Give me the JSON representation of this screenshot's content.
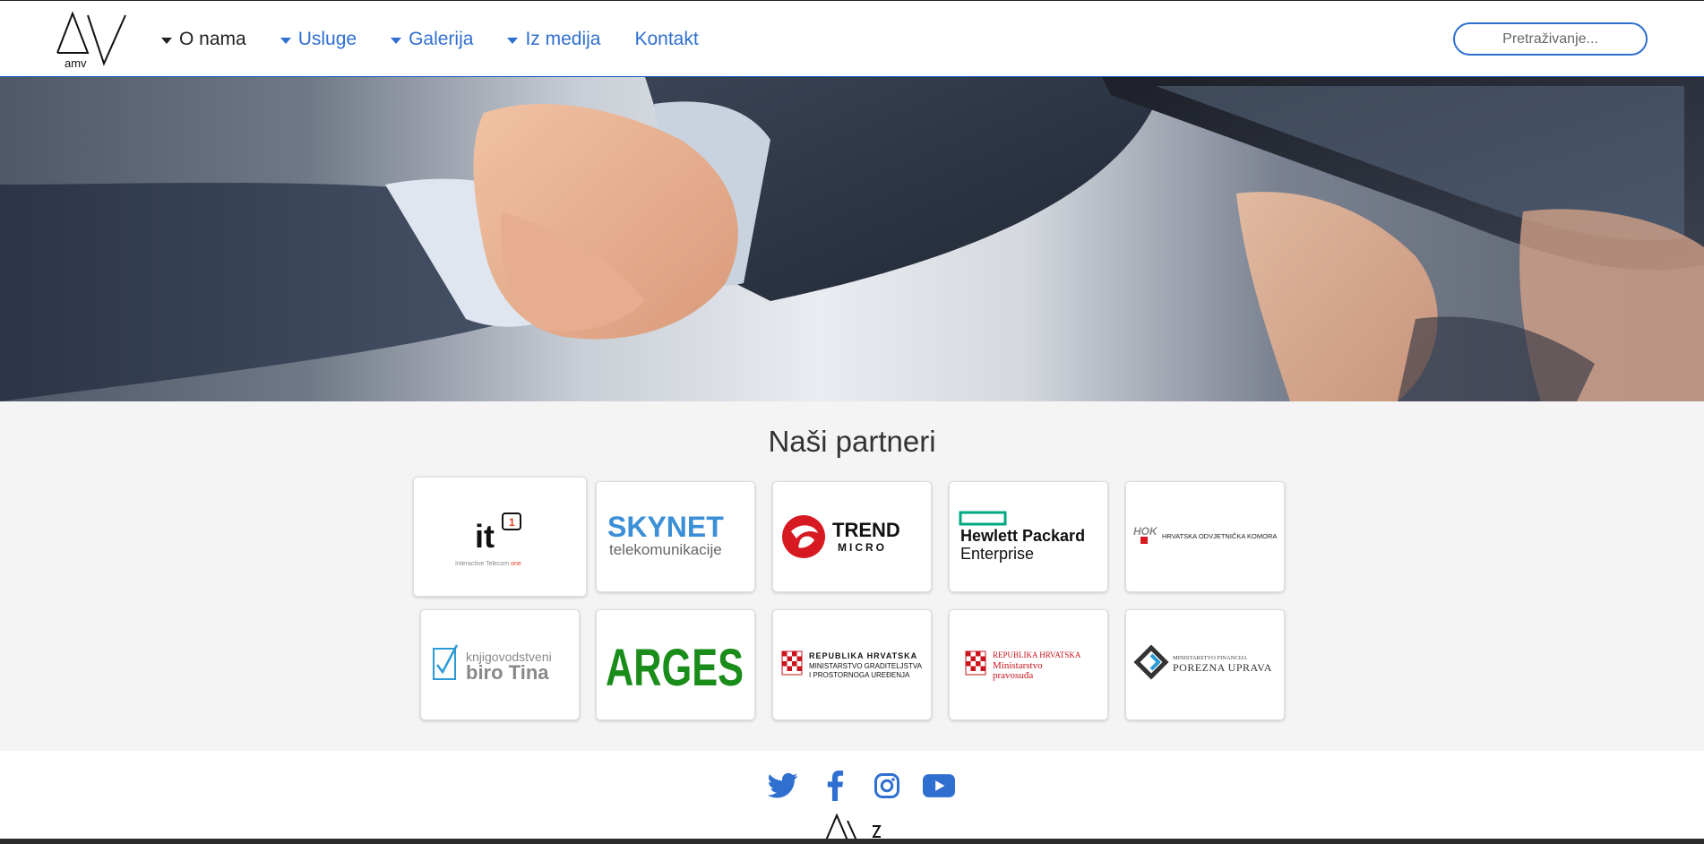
{
  "brand": {
    "logo_text": "amv"
  },
  "nav": {
    "items": [
      {
        "label": "O nama",
        "dropdown": true,
        "active": true
      },
      {
        "label": "Usluge",
        "dropdown": true,
        "active": false
      },
      {
        "label": "Galerija",
        "dropdown": true,
        "active": false
      },
      {
        "label": "Iz medija",
        "dropdown": true,
        "active": false
      },
      {
        "label": "Kontakt",
        "dropdown": false,
        "active": false
      }
    ],
    "search_placeholder": "Pretraživanje..."
  },
  "hero": {
    "image": "handshake-business-image"
  },
  "partners": {
    "title": "Naši partneri",
    "logos": [
      {
        "name": "it1",
        "text": "it",
        "badge": "1",
        "tagline": "Interactive Telecom ",
        "tagline_accent": "one"
      },
      {
        "name": "skynet",
        "text": "SKYNET",
        "subtext": "telekomunikacije"
      },
      {
        "name": "trend-micro",
        "text": "TREND",
        "subtext": "MICRO"
      },
      {
        "name": "hewlett-packard-enterprise",
        "text": "Hewlett Packard",
        "subtext": "Enterprise"
      },
      {
        "name": "hok",
        "mark": "HOK",
        "text": "HRVATSKA ODVJETNIČKA KOMORA"
      },
      {
        "name": "biro-tina",
        "text": "knjigovodstveni",
        "subtext": "biro Tina"
      },
      {
        "name": "arges",
        "text": "ARGES"
      },
      {
        "name": "ministarstvo-graditeljstva",
        "text": "REPUBLIKA HRVATSKA",
        "line2": "MINISTARSTVO GRADITELJSTVA",
        "line3": "I PROSTORNOGA UREĐENJA"
      },
      {
        "name": "ministarstvo-pravosudja",
        "text": "REPUBLIKA HRVATSKA",
        "line2": "Ministarstvo",
        "line3": "pravosuđa"
      },
      {
        "name": "porezna-uprava",
        "text": "MINISTARSTVO FINANCIJA",
        "subtext": "POREZNA UPRAVA"
      }
    ]
  },
  "footer": {
    "social": [
      "twitter-icon",
      "facebook-icon",
      "instagram-icon",
      "youtube-icon"
    ],
    "accent_color": "#2f6fd0"
  },
  "colors": {
    "link": "#2f6fd0",
    "nav_border": "#1a5bbd",
    "section_bg": "#f4f4f4"
  }
}
